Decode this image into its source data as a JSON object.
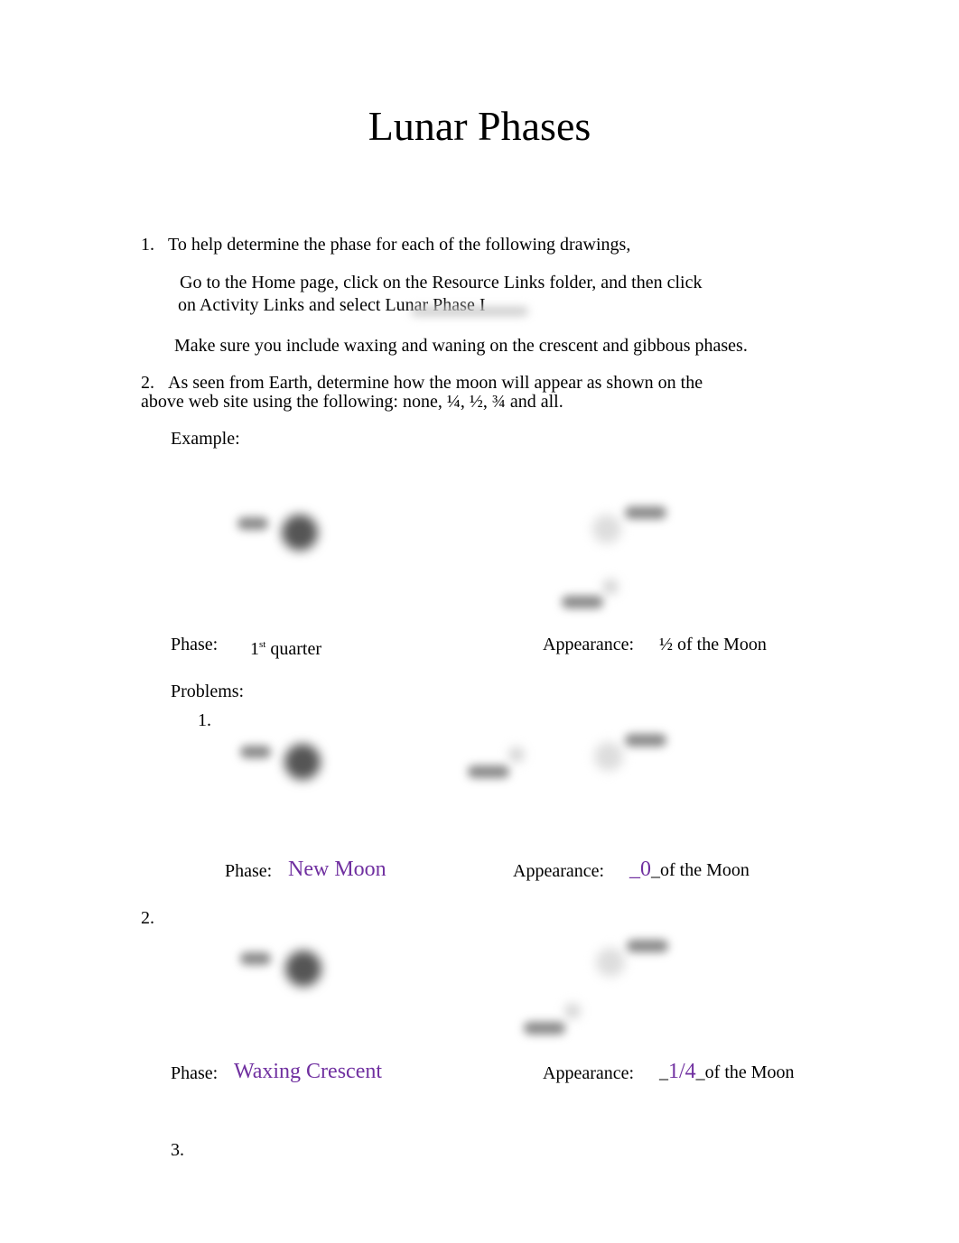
{
  "document": {
    "title": "Lunar Phases",
    "step1": {
      "number": "1.",
      "text": "To help determine the phase for each of the following drawings,",
      "line2": "Go to the Home page, click on the Resource Links folder, and then click",
      "line3": "on Activity Links and select Lunar Phase I",
      "note": "Make sure you include waxing and waning on the crescent and gibbous phases."
    },
    "step2": {
      "number": "2.",
      "text": "As seen from Earth, determine how the moon will appear as shown on the",
      "line2": "above web site using the following: none, ¼, ½, ¾ and all."
    },
    "example": {
      "label": "Example:",
      "phase_label": "Phase:",
      "phase_value_main": "1",
      "phase_value_sup": "st",
      "phase_value_rest": " quarter",
      "appearance_label": "Appearance:",
      "appearance_value": "½ of the Moon"
    },
    "problems_label": "Problems:",
    "problems": [
      {
        "number": "1.",
        "phase_label": "Phase:",
        "phase_answer": "New Moon",
        "appearance_label": "Appearance:",
        "appearance_prefix": "_",
        "appearance_answer": "0",
        "appearance_suffix": "_of the Moon"
      },
      {
        "number": "2.",
        "phase_label": "Phase:",
        "phase_answer": "Waxing Crescent",
        "appearance_label": "Appearance:",
        "appearance_prefix": "_",
        "appearance_answer": "1/4",
        "appearance_suffix": "_of the Moon"
      },
      {
        "number": "3."
      }
    ],
    "colors": {
      "answer": "#7030a0"
    }
  }
}
